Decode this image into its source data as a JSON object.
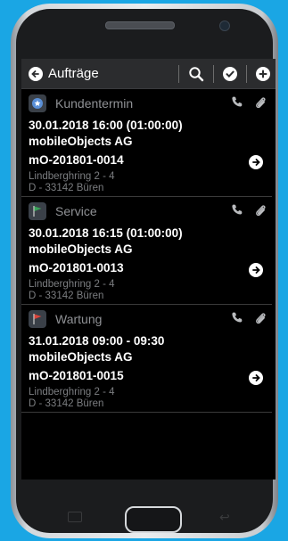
{
  "appbar": {
    "title": "Aufträge",
    "icons": [
      "back-icon",
      "search-icon",
      "check-icon",
      "add-icon"
    ]
  },
  "orders": [
    {
      "type": "Kundentermin",
      "type_icon": "calendar-icon",
      "datetime": "30.01.2018 16:00 (01:00:00)",
      "company": "mobileObjects AG",
      "number": "mO-201801-0014",
      "street": "Lindberghring 2 - 4",
      "city": "D - 33142 Büren"
    },
    {
      "type": "Service",
      "type_icon": "green-flag-icon",
      "datetime": "30.01.2018 16:15 (01:00:00)",
      "company": "mobileObjects AG",
      "number": "mO-201801-0013",
      "street": "Lindberghring 2 - 4",
      "city": "D - 33142 Büren"
    },
    {
      "type": "Wartung",
      "type_icon": "red-flag-icon",
      "datetime": "31.01.2018 09:00 - 09:30",
      "company": "mobileObjects AG",
      "number": "mO-201801-0015",
      "street": "Lindberghring 2 - 4",
      "city": "D - 33142 Büren"
    }
  ],
  "colors": {
    "background": "#1aa6e4",
    "appbar": "#2b2c2e",
    "muted_text": "#7b7d80",
    "green_flag": "#3aa35a",
    "red_flag": "#d9443a"
  }
}
